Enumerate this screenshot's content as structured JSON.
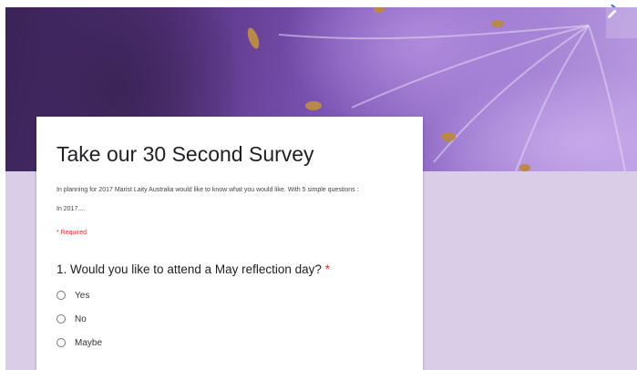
{
  "form": {
    "title": "Take our 30 Second Survey",
    "description": "In planning for 2017 Marist Laity Australia would like to know what you would like. With 5 simple questions :",
    "description_line2": "In 2017....",
    "required_note": "* Required",
    "edit_icon": "pencil-icon"
  },
  "question1": {
    "text": "1. Would you like to attend a May reflection day?",
    "required_marker": "*",
    "options": [
      "Yes",
      "No",
      "Maybe"
    ]
  },
  "colors": {
    "page_background": "#d9cde8",
    "card": "#ffffff",
    "required": "#d93025",
    "accent_blue": "#1a73e8"
  }
}
